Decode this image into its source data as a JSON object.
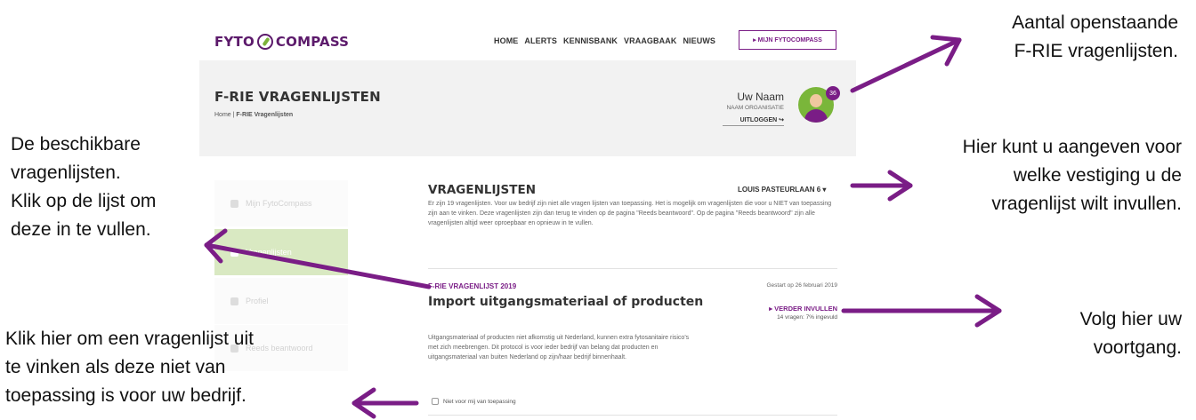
{
  "brand": {
    "logo_left": "FYTO",
    "logo_right": "COMPASS",
    "accent": "#7a1d86",
    "green": "#7ab63a"
  },
  "nav": {
    "items": [
      "HOME",
      "ALERTS",
      "KENNISBANK",
      "VRAAGBAAK",
      "NIEUWS"
    ],
    "cta": "▸ MIJN FYTOCOMPASS"
  },
  "header": {
    "title": "F-RIE VRAGENLIJSTEN",
    "breadcrumb_home": "Home",
    "breadcrumb_sep": " | ",
    "breadcrumb_current": "F-RIE Vragenlijsten",
    "user_name": "Uw Naam",
    "user_org": "NAAM ORGANISATIE",
    "logout": "UITLOGGEN ↪",
    "badge_count": "36"
  },
  "sidebar": {
    "items": [
      {
        "label": "Mijn FytoCompass",
        "icon": "home-icon"
      },
      {
        "label": "Vragenlijsten",
        "icon": "list-icon"
      },
      {
        "label": "Profiel",
        "icon": "user-icon"
      },
      {
        "label": "Reeds beantwoord",
        "icon": "check-icon"
      }
    ]
  },
  "main": {
    "section_title": "VRAGENLIJSTEN",
    "location_select": "LOUIS PASTEURLAAN 6 ▾",
    "intro": "Er zijn 19 vragenlijsten. Voor uw bedrijf zijn niet alle vragen lijsten van toepassing. Het is mogelijk om vragenlijsten die voor u NIET van toepassing zijn aan te vinken. Deze vragenlijsten zijn dan terug te vinden op de pagina \"Reeds beantwoord\". Op de pagina \"Reeds beantwoord\" zijn alle vragenlijsten altijd weer oproepbaar en opnieuw in te vullen.",
    "card": {
      "subtitle": "F-RIE VRAGENLIJST 2019",
      "started": "Gestart op 26 februari 2019",
      "title": "Import uitgangsmateriaal of producten",
      "continue": "▸ VERDER INVULLEN",
      "progress": "14 vragen: 7% ingevuld",
      "description": "Uitgangsmateriaal of producten niet afkomstig uit Nederland, kunnen extra fytosanitaire risico's met zich meebrengen. Dit protocol is voor ieder bedrijf van belang dat producten en uitgangsmateriaal van buiten Nederland op zijn/haar bedrijf binnenhaalt.",
      "checkbox_label": "Niet voor mij van toepassing"
    }
  },
  "annotations": {
    "top_right": [
      "Aantal openstaande",
      "F-RIE vragenlijsten."
    ],
    "left_1": [
      "De beschikbare",
      "vragenlijsten.",
      "Klik op de lijst om",
      "deze in te vullen."
    ],
    "right_2": [
      "Hier kunt u aangeven voor",
      "welke vestiging u de",
      "vragenlijst wilt invullen."
    ],
    "right_3": [
      "Volg hier uw",
      "voortgang."
    ],
    "left_2": [
      "Klik hier om een vragenlijst uit",
      "te vinken als deze niet van",
      "toepassing is voor uw bedrijf."
    ],
    "arrow_color": "#7a1d86"
  }
}
